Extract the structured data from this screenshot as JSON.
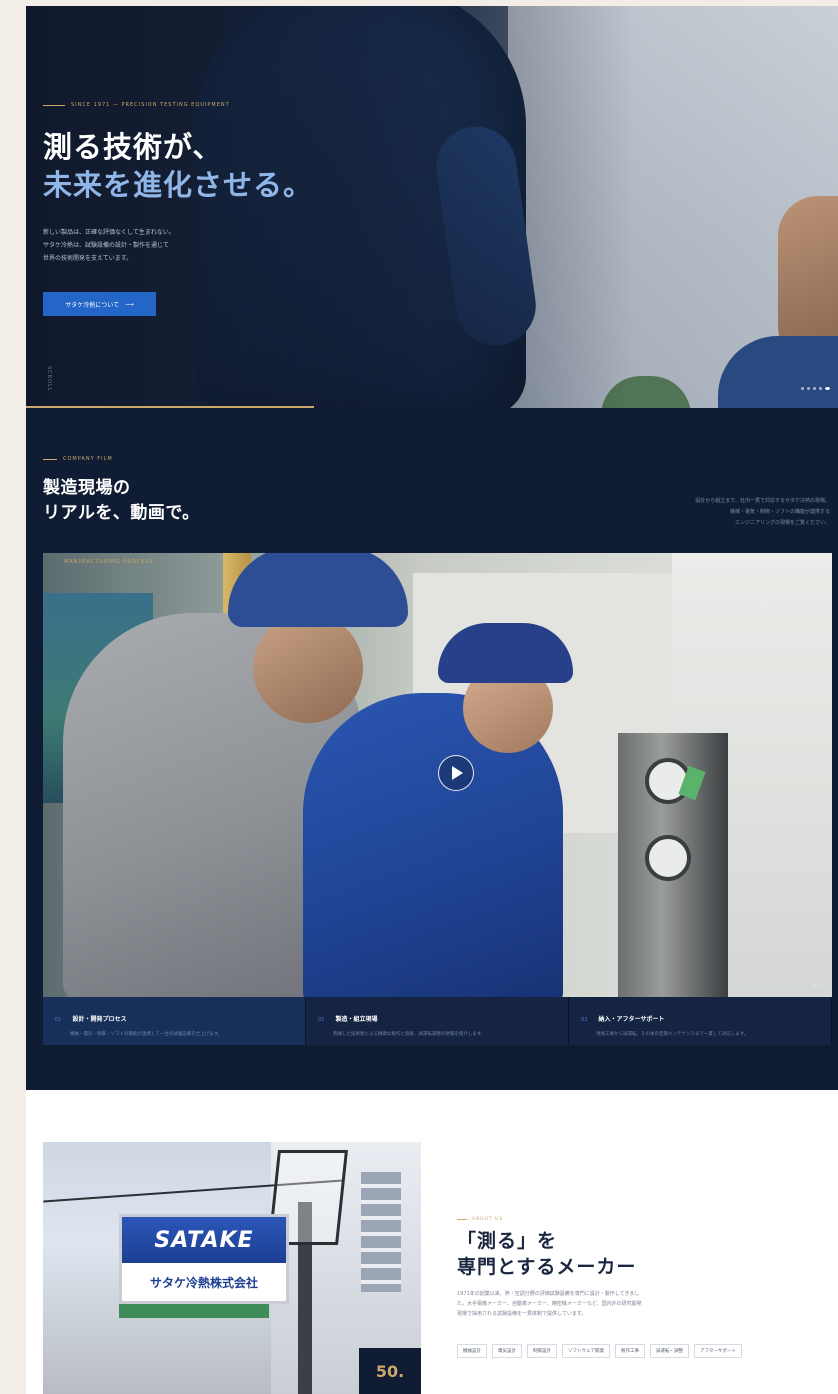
{
  "hero": {
    "eyebrow": "SINCE 1971 — PRECISION TESTING EQUIPMENT",
    "title_line1": "測る技術が、",
    "title_line2": "未来を進化させる。",
    "desc_line1": "新しい製品は、正確な評価なくして生まれない。",
    "desc_line2": "サタケ冷熱は、試験設備の設計・製作を通じて",
    "desc_line3": "世界の技術開発を支えています。",
    "cta_label": "サタケ冷熱について",
    "cta_arrow": "⟶",
    "vertical_label": "SCROLL",
    "accent_color": "#8fb6e6",
    "gold_color": "#c9a86a"
  },
  "film": {
    "eyebrow": "COMPANY FILM",
    "title_line1": "製造現場の",
    "title_line2": "リアルを、動画で。",
    "desc_line1": "設計から組立まで、社内一貫で対応するサタケ冷熱の現場。",
    "desc_line2": "機械・電気・制御・ソフトの職能が連携する",
    "desc_line3": "エンジニアリングの現場をご覧ください。",
    "video_label": "MANUFACTURING PROCESS",
    "duration": "3:24",
    "steps": [
      {
        "num": "01",
        "name": "設計・開発プロセス",
        "desc": "機械・電気・制御・ソフトの職能が連携して一台の試験設備を仕上げます。"
      },
      {
        "num": "02",
        "name": "製造・組立現場",
        "desc": "熟練した技術者による精緻な製作と溶接、試運転調整の現場を紹介します。"
      },
      {
        "num": "03",
        "name": "納入・アフターサポート",
        "desc": "現地工事から試運転、その後の定期メンテナンスまで一貫して対応します。"
      }
    ]
  },
  "about": {
    "eyebrow": "ABOUT US",
    "title_line1": "「測る」を",
    "title_line2": "専門とするメーカー",
    "desc_line1": "1971年の創業以来、熱・空調分野の評価試験設備を専門に設計・製作してきまし",
    "desc_line2": "た。大手電機メーカー、自動車メーカー、精密機メーカーなど、国内外の研究開発",
    "desc_line3": "現場で採用される試験設備を一貫体制で提供しています。",
    "tags": [
      "機械設計",
      "電気設計",
      "制御設計",
      "ソフトウェア開発",
      "製作工事",
      "試運転・調整",
      "アフターサポート"
    ],
    "sign_top": "SATAKE",
    "sign_bottom": "サタケ冷熱株式会社",
    "badge": "50."
  }
}
